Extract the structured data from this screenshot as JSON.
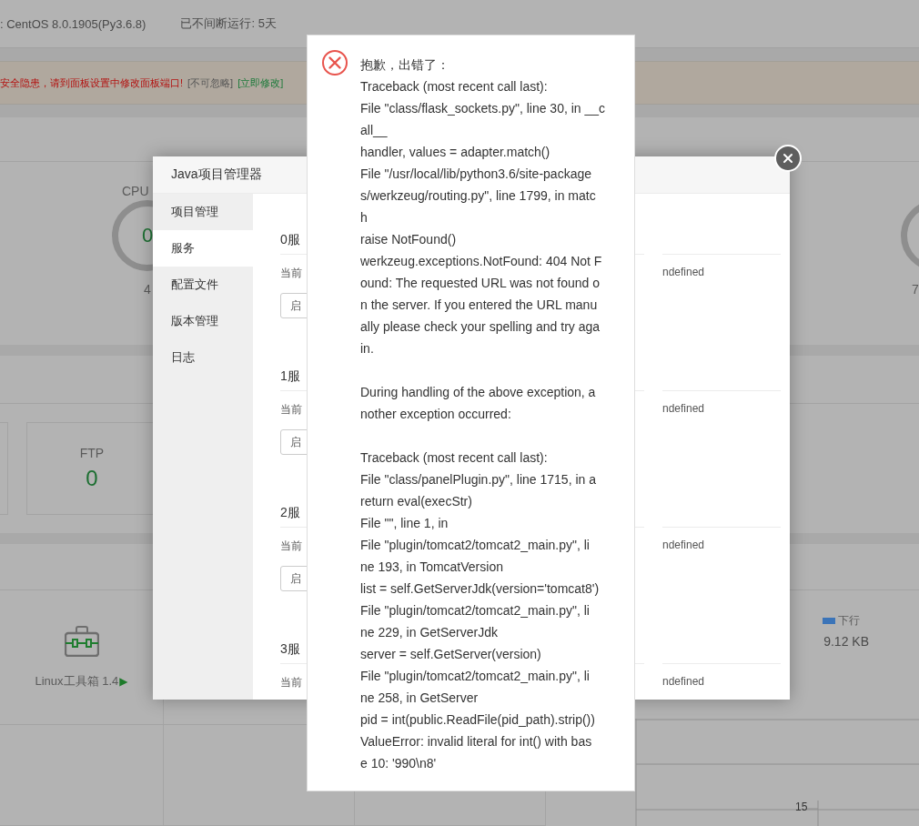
{
  "header": {
    "system": ": CentOS 8.0.1905(Py3.6.8)",
    "uptime": "已不间断运行: 5天"
  },
  "warning": {
    "message": "安全隐患，请到面板设置中修改面板端口!",
    "ignore": "[不可忽略]",
    "fix": "[立即修改]"
  },
  "gauges": [
    {
      "label": "CPU",
      "value": "0",
      "caption": "4"
    },
    {
      "caption": "7"
    }
  ],
  "cards": [
    {
      "title": "FTP",
      "value": "0"
    }
  ],
  "software": [
    {
      "name": "Linux工具箱 1.4",
      "arrow": "▶"
    }
  ],
  "network": {
    "legend": "下行",
    "value": "9.12 KB",
    "axis_tick": "15"
  },
  "java_dialog": {
    "title": "Java项目管理器",
    "tabs": [
      {
        "label": "项目管理",
        "selected": false
      },
      {
        "label": "服务",
        "selected": true
      },
      {
        "label": "配置文件",
        "selected": false
      },
      {
        "label": "版本管理",
        "selected": false
      },
      {
        "label": "日志",
        "selected": false
      }
    ],
    "services": [
      {
        "title": "0服",
        "status_label": "当前",
        "button": "启",
        "status_value": "ndefined"
      },
      {
        "title": "1服",
        "status_label": "当前",
        "button": "启",
        "status_value": "ndefined"
      },
      {
        "title": "2服",
        "status_label": "当前",
        "button": "启",
        "status_value": "ndefined"
      },
      {
        "title": "3服",
        "status_label": "当前",
        "status_value": "ndefined"
      }
    ]
  },
  "error_dialog": {
    "title": "抱歉，出错了：",
    "paragraphs": [
      [
        "Traceback (most recent call last):",
        "File \"class/flask_sockets.py\", line 30, in __c",
        "all__",
        "handler, values = adapter.match()",
        "File \"/usr/local/lib/python3.6/site-package",
        "s/werkzeug/routing.py\", line 1799, in matc",
        "h",
        "raise NotFound()",
        "werkzeug.exceptions.NotFound: 404 Not F",
        "ound: The requested URL was not found o",
        "n the server. If you entered the URL manu",
        "ally please check your spelling and try aga",
        "in."
      ],
      [
        "During handling of the above exception, a",
        "nother exception occurred:"
      ],
      [
        "Traceback (most recent call last):",
        "File \"class/panelPlugin.py\", line 1715, in a",
        "return eval(execStr)",
        "File \"\", line 1, in",
        "File \"plugin/tomcat2/tomcat2_main.py\", li",
        "ne 193, in TomcatVersion",
        "list = self.GetServerJdk(version='tomcat8')",
        "File \"plugin/tomcat2/tomcat2_main.py\", li",
        "ne 229, in GetServerJdk",
        "server = self.GetServer(version)",
        "File \"plugin/tomcat2/tomcat2_main.py\", li",
        "ne 258, in GetServer",
        "pid = int(public.ReadFile(pid_path).strip())",
        "ValueError: invalid literal for int() with bas",
        "e 10: '990\\n8'"
      ]
    ]
  }
}
